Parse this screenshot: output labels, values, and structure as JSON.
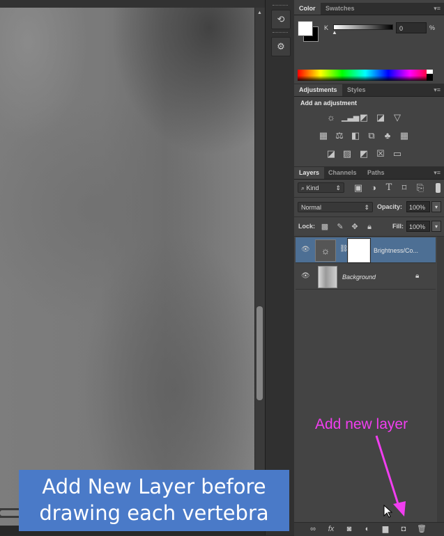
{
  "color_panel": {
    "tabs": [
      "Color",
      "Swatches"
    ],
    "channel_label": "K",
    "value": "0",
    "unit": "%"
  },
  "adjustments_panel": {
    "tabs": [
      "Adjustments",
      "Styles"
    ],
    "heading": "Add an adjustment",
    "row1_icons": [
      "brightness-contrast-icon",
      "levels-icon",
      "curves-icon",
      "exposure-icon",
      "gradient-triangle-icon"
    ],
    "row2_icons": [
      "vibrance-icon",
      "color-balance-icon",
      "black-white-icon",
      "photo-filter-icon",
      "channel-mixer-icon",
      "color-lookup-icon"
    ],
    "row3_icons": [
      "invert-icon",
      "posterize-icon",
      "threshold-icon",
      "selective-color-icon",
      "gradient-map-icon"
    ]
  },
  "layers_panel": {
    "tabs": [
      "Layers",
      "Channels",
      "Paths"
    ],
    "filter_kind": "Kind",
    "blend_mode": "Normal",
    "opacity_label": "Opacity:",
    "opacity_value": "100%",
    "lock_label": "Lock:",
    "fill_label": "Fill:",
    "fill_value": "100%",
    "layers": [
      {
        "name": "Brightness/Co...",
        "type": "adjustment",
        "selected": true
      },
      {
        "name": "Background",
        "type": "image",
        "selected": false,
        "locked": true
      }
    ],
    "footer_icons": [
      "link-icon",
      "fx-icon",
      "mask-icon",
      "adjustment-layer-icon",
      "group-folder-icon",
      "new-layer-icon",
      "trash-icon"
    ]
  },
  "annotations": {
    "new_layer_hint": "Add new layer",
    "caption_line1": "Add New Layer before",
    "caption_line2": "drawing each vertebra"
  },
  "colors": {
    "annotation_magenta": "#f13ef0",
    "caption_blue": "#4a7ac8",
    "selected_layer": "#4d6f94"
  }
}
